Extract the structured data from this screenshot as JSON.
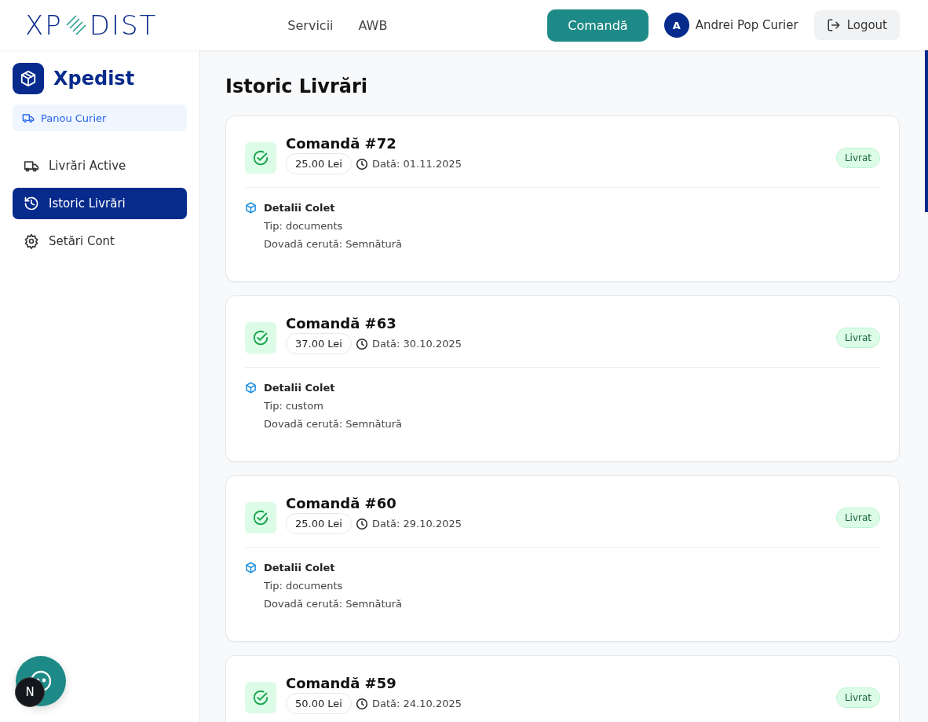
{
  "header": {
    "logo_left": "XP",
    "logo_right": "DIST",
    "nav": [
      "Servicii",
      "AWB"
    ],
    "order_button": "Comandă",
    "user": {
      "initial": "A",
      "name": "Andrei Pop Curier"
    },
    "logout": "Logout"
  },
  "sidebar": {
    "brand": "Xpedist",
    "role": "Panou Curier",
    "items": [
      {
        "label": "Livrări Active",
        "kind": "truck",
        "selected": false
      },
      {
        "label": "Istoric Livrări",
        "kind": "history",
        "selected": true
      },
      {
        "label": "Setări Cont",
        "kind": "gear",
        "selected": false
      }
    ]
  },
  "page_title": "Istoric Livrări",
  "orders": [
    {
      "title": "Comandă #72",
      "price": "25.00 Lei",
      "date": "Dată: 01.11.2025",
      "status": "Livrat",
      "details_title": "Detalii Colet",
      "type": "Tip: documents",
      "proof": "Dovadă cerută: Semnătură"
    },
    {
      "title": "Comandă #63",
      "price": "37.00 Lei",
      "date": "Dată: 30.10.2025",
      "status": "Livrat",
      "details_title": "Detalii Colet",
      "type": "Tip: custom",
      "proof": "Dovadă cerută: Semnătură"
    },
    {
      "title": "Comandă #60",
      "price": "25.00 Lei",
      "date": "Dată: 29.10.2025",
      "status": "Livrat",
      "details_title": "Detalii Colet",
      "type": "Tip: documents",
      "proof": "Dovadă cerută: Semnătură"
    },
    {
      "title": "Comandă #59",
      "price": "50.00 Lei",
      "date": "Dată: 24.10.2025",
      "status": "Livrat"
    }
  ],
  "dev_badge": "N"
}
